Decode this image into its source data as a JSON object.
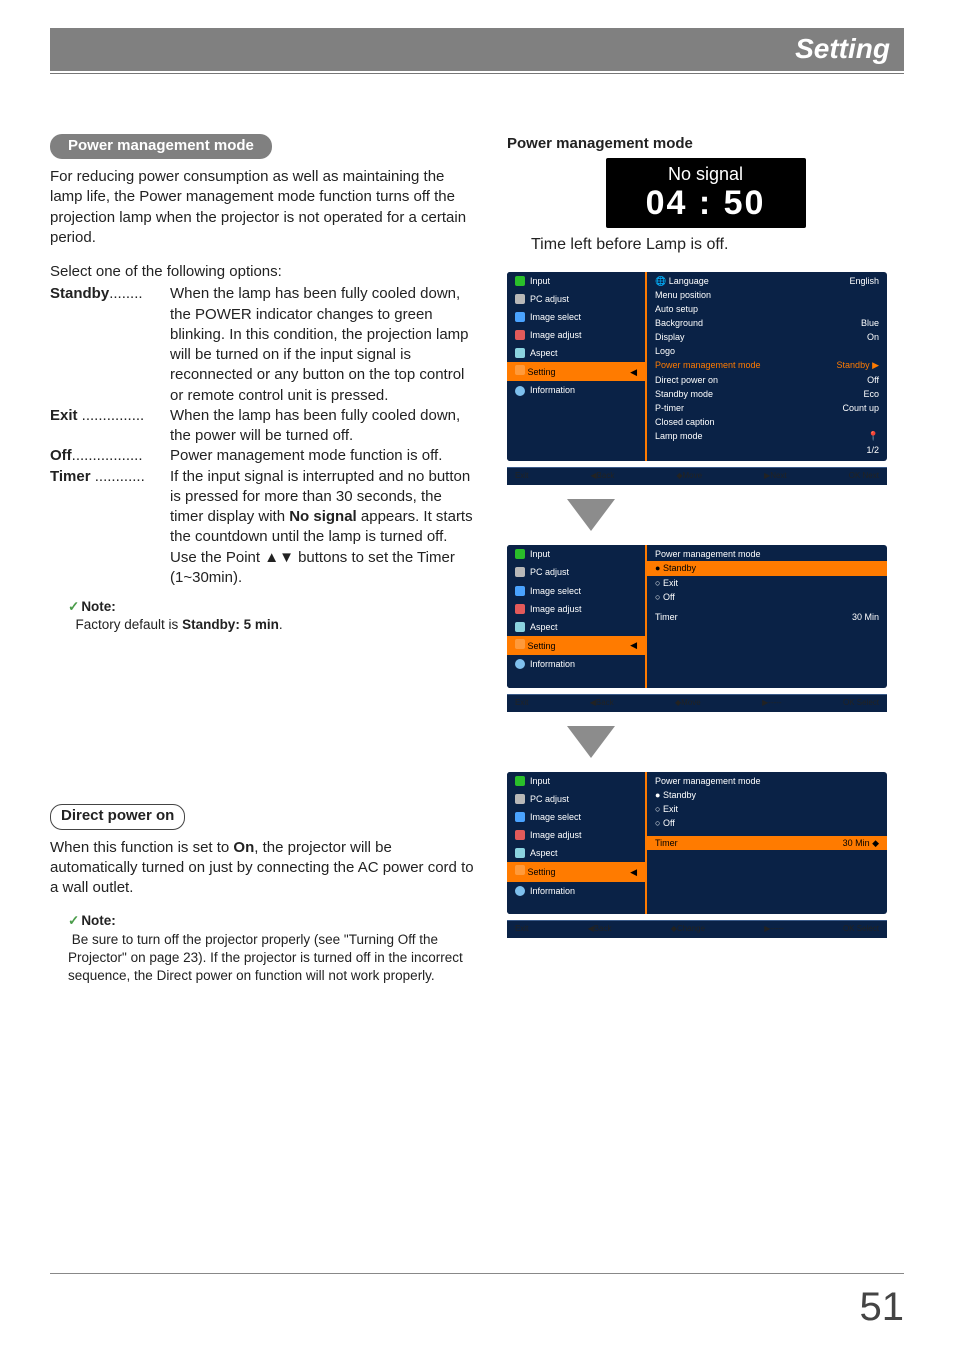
{
  "header": {
    "title": "Setting"
  },
  "pm": {
    "heading": "Power management mode",
    "intro": "For reducing power consumption as well as maintaining the lamp life, the Power management mode function turns off the projection lamp when the projector is not operated for a certain period.",
    "select_prompt": "Select one of the following options:",
    "options": [
      {
        "term": "Standby",
        "desc": "When the lamp has been fully cooled down, the POWER indicator changes to green blinking. In this condition, the projection lamp will be turned on if the input signal is reconnected or any button on the top control or remote control unit is pressed."
      },
      {
        "term": "Exit",
        "desc": "When the lamp has been fully cooled down, the power will be turned off."
      },
      {
        "term": "Off",
        "desc": "Power management mode function is off."
      },
      {
        "term": "Timer",
        "desc": "If the input signal is interrupted and no button is pressed for more than 30 seconds, the timer display with No signal appears. It starts the countdown until the lamp is turned off. Use the Point ▲▼ buttons to set the Timer (1~30min)."
      }
    ],
    "note_label": "Note:",
    "note_text_prefix": "Factory default is ",
    "note_text_bold": "Standby: 5 min",
    "note_text_suffix": "."
  },
  "dp": {
    "heading": "Direct power on",
    "text_prefix": "When this function is set to ",
    "text_bold": "On",
    "text_suffix": ", the projector will be automatically turned on just by connecting the AC power cord to a wall outlet.",
    "note_label": "Note:",
    "note_text": "Be sure to turn off the projector properly (see \"Turning Off the Projector\" on page 23). If the projector is turned off in the incorrect sequence, the Direct power on function will not work properly."
  },
  "right": {
    "title": "Power management mode",
    "nosignal": {
      "label": "No signal",
      "time": "04 : 50"
    },
    "caption": "Time left before Lamp is off.",
    "sidebar": [
      {
        "label": "Input",
        "icon": "green"
      },
      {
        "label": "PC adjust",
        "icon": "gray"
      },
      {
        "label": "Image select",
        "icon": "blue"
      },
      {
        "label": "Image adjust",
        "icon": "red"
      },
      {
        "label": "Aspect",
        "icon": "cyan"
      },
      {
        "label": "Setting",
        "icon": "orange",
        "active": true
      },
      {
        "label": "Information",
        "icon": "info"
      }
    ],
    "osd1": {
      "rows": [
        {
          "l": "Language",
          "r": "English"
        },
        {
          "l": "Menu position",
          "r": ""
        },
        {
          "l": "Auto setup",
          "r": ""
        },
        {
          "l": "Background",
          "r": "Blue"
        },
        {
          "l": "Display",
          "r": "On"
        },
        {
          "l": "Logo",
          "r": ""
        },
        {
          "l": "Power management mode",
          "r": "Standby  ▶",
          "hlred": true
        },
        {
          "l": "Direct power on",
          "r": "Off"
        },
        {
          "l": "Standby mode",
          "r": "Eco"
        },
        {
          "l": "P-timer",
          "r": "Count up"
        },
        {
          "l": "Closed caption",
          "r": ""
        },
        {
          "l": "Lamp mode",
          "r": ""
        }
      ],
      "page": "1/2",
      "footer": [
        "Exit",
        "◀Back",
        "◆Move",
        "▶Next",
        "OK Next"
      ]
    },
    "osd2": {
      "title": "Power management mode",
      "opts": [
        "Standby",
        "Exit",
        "Off"
      ],
      "timer_l": "Timer",
      "timer_r": "30 Min",
      "footer": [
        "Exit",
        "◀Back",
        "◆Move",
        "▶-----",
        "OK Select"
      ]
    },
    "osd3": {
      "title": "Power management mode",
      "opts": [
        "Standby",
        "Exit",
        "Off"
      ],
      "timer_l": "Timer",
      "timer_r": "30 Min   ◆",
      "footer": [
        "Exit",
        "◀Back",
        "◆Change",
        "▶-----",
        "OK Select"
      ]
    }
  },
  "page_number": "51"
}
